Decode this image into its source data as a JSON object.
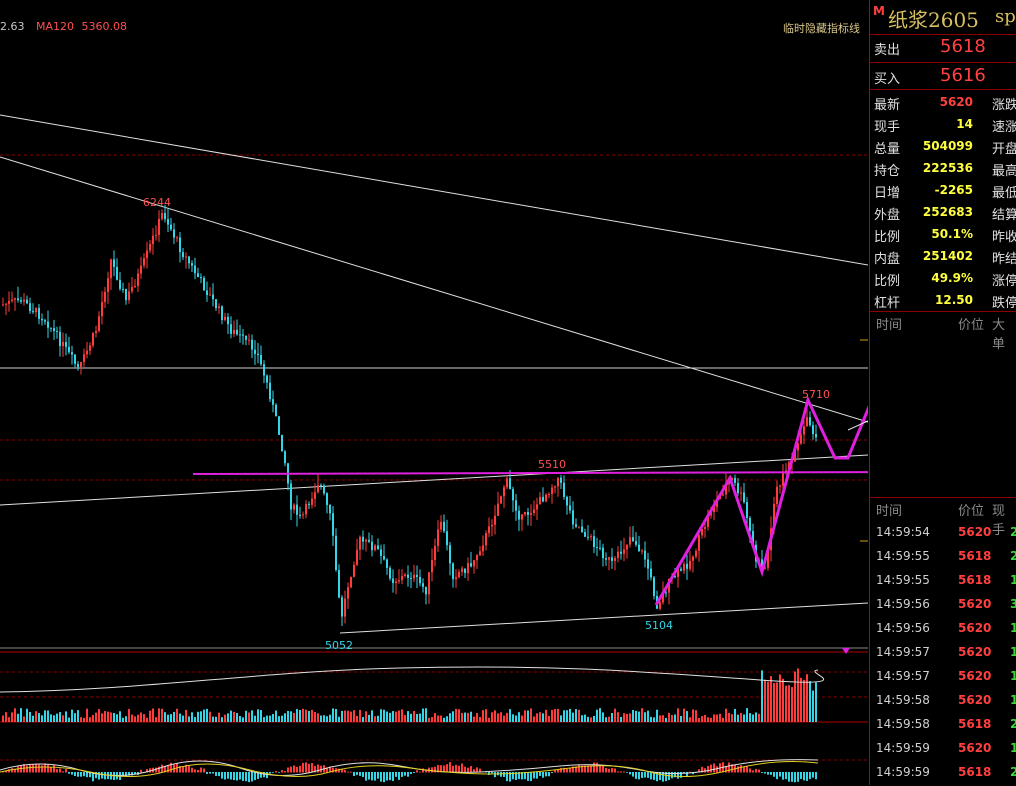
{
  "legend": {
    "ma_prev": "2.63",
    "ma120_label": "MA120",
    "ma120_value": "5360.08"
  },
  "hide_lines_button": "临时隐藏指标线",
  "price_labels": {
    "high": "6244",
    "mid_high": "5510",
    "low": "5052",
    "low2": "5104",
    "recent_high": "5710"
  },
  "quote": {
    "symbol_badge": "M",
    "name": "纸浆2605",
    "code_partial": "sp",
    "ask_label": "卖出",
    "ask_value": "5618",
    "bid_label": "买入",
    "bid_value": "5616",
    "rows": [
      {
        "label": "最新",
        "value": "5620",
        "right": "涨跌"
      },
      {
        "label": "现手",
        "value": "14",
        "right": "速涨"
      },
      {
        "label": "总量",
        "value": "504099",
        "right": "开盘"
      },
      {
        "label": "持仓",
        "value": "222536",
        "right": "最高"
      },
      {
        "label": "日增",
        "value": "-2265",
        "right": "最低"
      },
      {
        "label": "外盘",
        "value": "252683",
        "right": "结算"
      },
      {
        "label": "比例",
        "value": "50.1%",
        "right": "昨收"
      },
      {
        "label": "内盘",
        "value": "251402",
        "right": "昨结"
      },
      {
        "label": "比例",
        "value": "49.9%",
        "right": "涨停"
      },
      {
        "label": "杠杆",
        "value": "12.50",
        "right": "跌停"
      }
    ],
    "big_header": {
      "time": "时间",
      "price": "价位",
      "vol": "大单"
    },
    "tick_header": {
      "time": "时间",
      "price": "价位",
      "vol": "现手"
    },
    "ticks": [
      {
        "time": "14:59:54",
        "price": "5620",
        "vol": "2"
      },
      {
        "time": "14:59:55",
        "price": "5618",
        "vol": "2"
      },
      {
        "time": "14:59:55",
        "price": "5618",
        "vol": "1"
      },
      {
        "time": "14:59:56",
        "price": "5620",
        "vol": "3"
      },
      {
        "time": "14:59:56",
        "price": "5620",
        "vol": "1"
      },
      {
        "time": "14:59:57",
        "price": "5620",
        "vol": "1"
      },
      {
        "time": "14:59:57",
        "price": "5620",
        "vol": "1"
      },
      {
        "time": "14:59:58",
        "price": "5620",
        "vol": "1"
      },
      {
        "time": "14:59:58",
        "price": "5618",
        "vol": "2"
      },
      {
        "time": "14:59:59",
        "price": "5620",
        "vol": "1"
      },
      {
        "time": "14:59:59",
        "price": "5618",
        "vol": "2"
      }
    ]
  },
  "colors": {
    "up": "#ff3b3b",
    "down": "#33d6e6",
    "magenta": "#e020e0",
    "grid_red": "#8a0000",
    "value_yellow": "#ffff40",
    "value_red": "#ff4040"
  }
}
